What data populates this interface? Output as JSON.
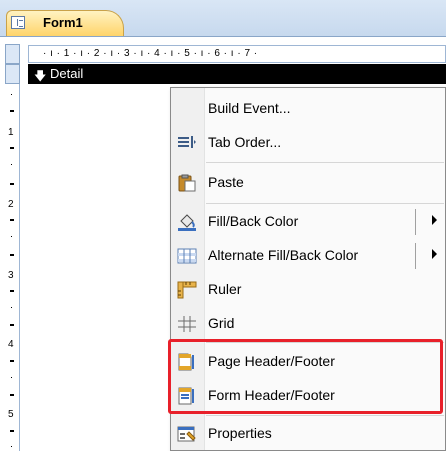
{
  "window": {
    "tab_title": "Form1",
    "ruler_text": "· ı · 1 · ı · 2 · ı · 3 · ı · 4 · ı · 5 · ı · 6 · ı · 7 ·",
    "vertical_ruler_numbers": [
      "1",
      "2",
      "3",
      "4",
      "5"
    ]
  },
  "section": {
    "label": "Detail",
    "arrow": "🡇"
  },
  "context_menu": {
    "items": [
      {
        "label": "Build Event...",
        "icon": "none"
      },
      {
        "label": "Tab Order...",
        "icon": "tab-order-icon"
      },
      {
        "label": "Paste",
        "icon": "clipboard-icon"
      },
      {
        "label": "Fill/Back Color",
        "icon": "paint-bucket-icon"
      },
      {
        "label": "Alternate Fill/Back Color",
        "icon": "alternate-grid-icon"
      },
      {
        "label": "Ruler",
        "icon": "ruler-icon"
      },
      {
        "label": "Grid",
        "icon": "grid-icon"
      },
      {
        "label": "Page Header/Footer",
        "icon": "page-header-icon"
      },
      {
        "label": "Form Header/Footer",
        "icon": "form-header-icon"
      },
      {
        "label": "Properties",
        "icon": "properties-icon"
      }
    ]
  },
  "colors": {
    "highlight": "#e8202a",
    "tab_gold": "#ffd46a",
    "chrome_blue": "#c7d9ee"
  }
}
